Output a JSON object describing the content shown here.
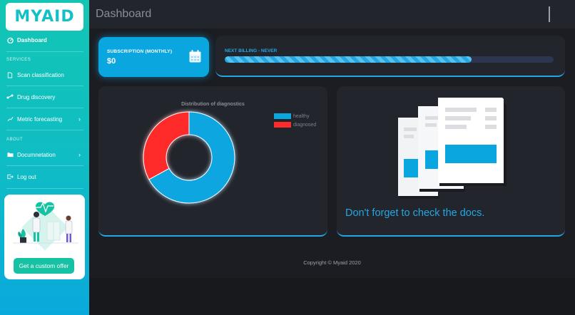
{
  "sidebar": {
    "logo": "MYAID",
    "dashboard": "Dashboard",
    "services_label": "SERVICES",
    "items": [
      {
        "label": "Scan classification"
      },
      {
        "label": "Drug discovery"
      },
      {
        "label": "Metric forecasting"
      }
    ],
    "about_label": "ABOUT",
    "about_items": [
      {
        "label": "Documnetation"
      },
      {
        "label": "Log out"
      }
    ],
    "promo_button": "Get a custom offer"
  },
  "header": {
    "title": "Dashboard"
  },
  "subscription": {
    "label": "SUBSCRIPTION (MONTHLY)",
    "value": "$0"
  },
  "billing": {
    "label": "NEXT BILLING - NEVER",
    "progress_fraction": 0.75
  },
  "chart_data": {
    "type": "pie",
    "title": "Distribution of diagnostics",
    "categories": [
      "healthy",
      "diagnosed"
    ],
    "values": [
      67,
      33
    ],
    "colors": [
      "#0aa6e0",
      "#ff2a2a"
    ],
    "legend": "top-right"
  },
  "docs": {
    "text": "Don't forget to check the docs."
  },
  "footer": {
    "copyright": "Copyright © Myaid 2020"
  },
  "colors": {
    "accent": "#22a7e4",
    "sidebar_top": "#12c6b3",
    "sidebar_bottom": "#0aa9dc",
    "promo_button": "#16c2a3"
  }
}
